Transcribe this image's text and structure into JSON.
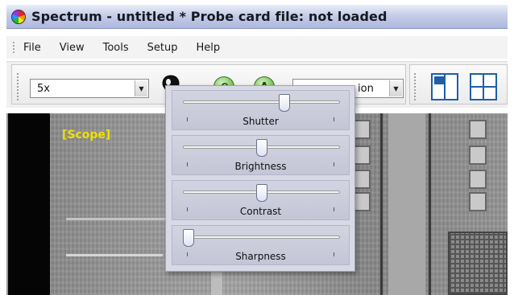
{
  "window": {
    "title": "Spectrum - untitled *  Probe card file: not loaded",
    "app_icon": "spectrum-logo-icon"
  },
  "menu": {
    "items": [
      "File",
      "View",
      "Tools",
      "Setup",
      "Help"
    ]
  },
  "toolbar": {
    "zoom_value": "5x",
    "camera_value": "ion",
    "illumination_icon": "lightbulb-icon",
    "round_button_1_glyph": "⟲",
    "round_button_2_glyph": "A",
    "view_single_icon": "layout-split-icon",
    "view_quad_icon": "layout-quad-icon"
  },
  "scope": {
    "label": "[Scope]",
    "label_color": "#f0e000"
  },
  "popup": {
    "sliders": [
      {
        "label": "Shutter",
        "level": 0.66
      },
      {
        "label": "Brightness",
        "level": 0.5
      },
      {
        "label": "Contrast",
        "level": 0.5
      },
      {
        "label": "Sharpness",
        "level": 0.0
      }
    ]
  },
  "colors": {
    "titlebar": "#c5cde8",
    "accent": "#1e5fa8",
    "popup_bg": "#d8d9e4"
  }
}
